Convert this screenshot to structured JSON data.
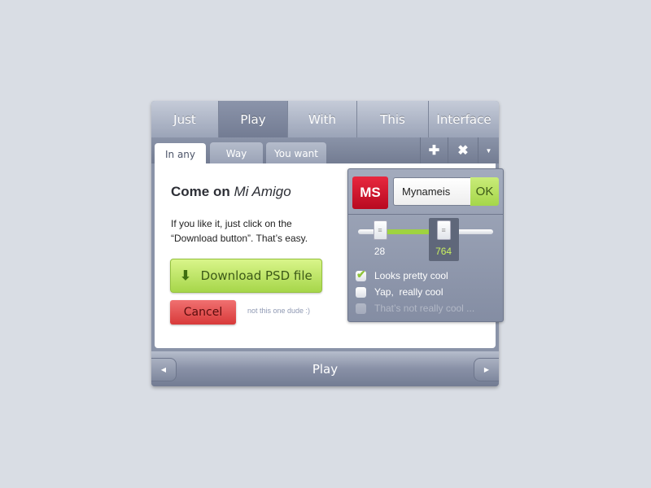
{
  "top_tabs": [
    {
      "label": "Just"
    },
    {
      "label": "Play",
      "active": true
    },
    {
      "label": "With"
    },
    {
      "label": "This"
    },
    {
      "label": "Interface"
    }
  ],
  "sub_tabs": [
    {
      "label": "In any",
      "active": true
    },
    {
      "label": "Way"
    },
    {
      "label": "You want"
    }
  ],
  "toolbar": {
    "add_icon": "plus-icon",
    "close_icon": "x-icon",
    "menu_icon": "triangle-down-icon"
  },
  "content": {
    "title_bold": "Come on",
    "title_italic": "Mi Amigo",
    "body_line1": "If you like it, just click on the",
    "body_line2": "“Download button”. That’s easy.",
    "download_label": "Download PSD file",
    "cancel_label": "Cancel",
    "cancel_note": "not this one dude :)"
  },
  "popup": {
    "logo": "MS",
    "name_value": "Mynameis",
    "ok_label": "OK",
    "slider": {
      "low": 28,
      "high": 764,
      "low_fraction": 0.16,
      "high_fraction": 0.63
    },
    "checkboxes": [
      {
        "label": "Looks pretty cool",
        "checked": true
      },
      {
        "label": "Yap,  really cool",
        "checked": false
      },
      {
        "label": "That’s not really cool ...",
        "checked": false,
        "disabled": true
      }
    ]
  },
  "bottom": {
    "label": "Play"
  },
  "colors": {
    "accent_green": "#a8d94a",
    "cancel_red": "#e04444",
    "logo_red": "#d2102b"
  }
}
